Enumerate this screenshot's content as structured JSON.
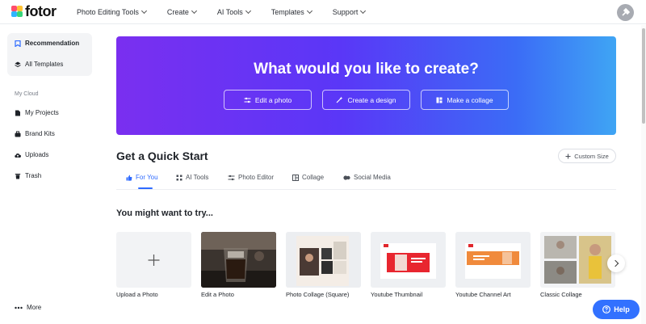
{
  "brand": {
    "name": "fotor"
  },
  "nav": {
    "items": [
      {
        "label": "Photo Editing Tools"
      },
      {
        "label": "Create"
      },
      {
        "label": "AI Tools"
      },
      {
        "label": "Templates"
      },
      {
        "label": "Support"
      }
    ]
  },
  "sidebar": {
    "items": [
      {
        "label": "Recommendation",
        "icon": "bookmark-icon"
      },
      {
        "label": "All Templates",
        "icon": "layers-icon"
      }
    ],
    "cloud_caption": "My Cloud",
    "cloud_items": [
      {
        "label": "My Projects",
        "icon": "document-icon"
      },
      {
        "label": "Brand Kits",
        "icon": "briefcase-icon"
      },
      {
        "label": "Uploads",
        "icon": "cloud-upload-icon"
      },
      {
        "label": "Trash",
        "icon": "trash-icon"
      }
    ],
    "more_label": "More"
  },
  "hero": {
    "title": "What would you like to create?",
    "buttons": [
      {
        "label": "Edit a photo",
        "icon": "sliders-icon"
      },
      {
        "label": "Create a design",
        "icon": "magic-wand-icon"
      },
      {
        "label": "Make a collage",
        "icon": "grid-icon"
      }
    ]
  },
  "quick_start": {
    "title": "Get a Quick Start",
    "custom_size_label": "Custom Size",
    "tabs": [
      {
        "label": "For You",
        "icon": "thumbs-up-icon"
      },
      {
        "label": "AI Tools",
        "icon": "ai-grid-icon"
      },
      {
        "label": "Photo Editor",
        "icon": "sliders-icon"
      },
      {
        "label": "Collage",
        "icon": "collage-icon"
      },
      {
        "label": "Social Media",
        "icon": "social-icon"
      }
    ]
  },
  "suggestions": {
    "title": "You might want to try...",
    "cards": [
      {
        "label": "Upload a Photo"
      },
      {
        "label": "Edit a Photo"
      },
      {
        "label": "Photo Collage (Square)"
      },
      {
        "label": "Youtube Thumbnail"
      },
      {
        "label": "Youtube Channel Art"
      },
      {
        "label": "Classic Collage"
      }
    ]
  },
  "help_label": "Help",
  "colors": {
    "accent": "#2f6bff",
    "hero_start": "#7a2ff0",
    "hero_end": "#3fa5f4",
    "help": "#3271ff"
  }
}
